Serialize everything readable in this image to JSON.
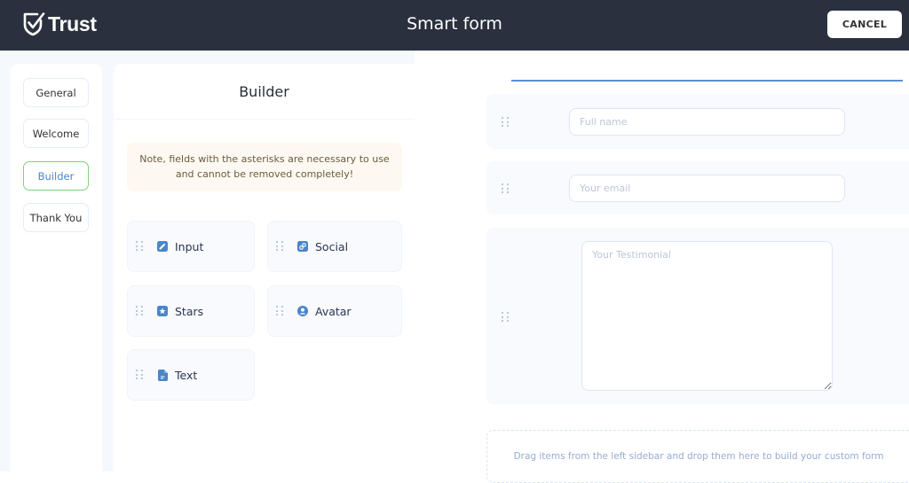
{
  "header": {
    "logo_text": "Trust",
    "title": "Smart form",
    "cancel_label": "CANCEL"
  },
  "nav": {
    "items": [
      {
        "label": "General",
        "active": false
      },
      {
        "label": "Welcome",
        "active": false
      },
      {
        "label": "Builder",
        "active": true
      },
      {
        "label": "Thank You",
        "active": false
      }
    ]
  },
  "builder": {
    "title": "Builder",
    "note": "Note, fields with the asterisks are necessary to use and cannot be removed completely!",
    "tools": [
      {
        "label": "Input",
        "icon": "pencil-icon"
      },
      {
        "label": "Social",
        "icon": "link-icon"
      },
      {
        "label": "Stars",
        "icon": "star-icon"
      },
      {
        "label": "Avatar",
        "icon": "user-circle-icon"
      },
      {
        "label": "Text",
        "icon": "document-icon"
      }
    ]
  },
  "form": {
    "fields": [
      {
        "type": "input",
        "placeholder": "Full name"
      },
      {
        "type": "input",
        "placeholder": "Your email"
      },
      {
        "type": "textarea",
        "placeholder": "Your Testimonial"
      }
    ],
    "drop_hint": "Drag items from the left sidebar and drop them here to build your custom form"
  },
  "colors": {
    "header_bg": "#2a303d",
    "accent_blue": "#4a86c8",
    "active_border": "#7ed37a",
    "icon_blue": "#4a86c8"
  }
}
